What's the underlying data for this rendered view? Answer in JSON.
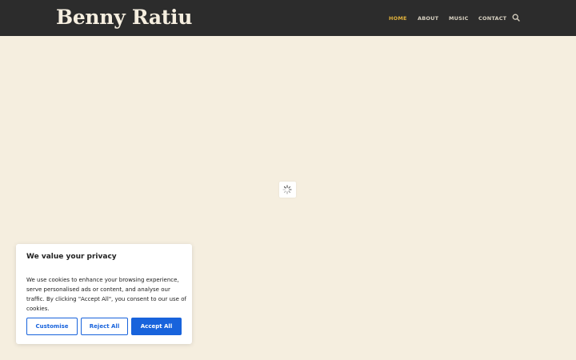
{
  "site": {
    "title": "Benny Ratiu"
  },
  "nav": {
    "items": [
      {
        "label": "HOME",
        "active": true
      },
      {
        "label": "ABOUT",
        "active": false
      },
      {
        "label": "MUSIC",
        "active": false
      },
      {
        "label": "CONTACT",
        "active": false
      }
    ],
    "search_icon": "search-icon"
  },
  "loader": {
    "icon": "spinner-icon"
  },
  "cookie_banner": {
    "title": "We value your privacy",
    "text": "We use cookies to enhance your browsing experience, serve personalised ads or content, and analyse our traffic. By clicking \"Accept All\", you consent to our use of cookies.",
    "customise_label": "Customise",
    "reject_label": "Reject All",
    "accept_label": "Accept All"
  },
  "colors": {
    "header_bg": "#2c2c2c",
    "page_bg": "#f5eedf",
    "nav_active": "#e0b13c",
    "accent": "#1863dc"
  }
}
